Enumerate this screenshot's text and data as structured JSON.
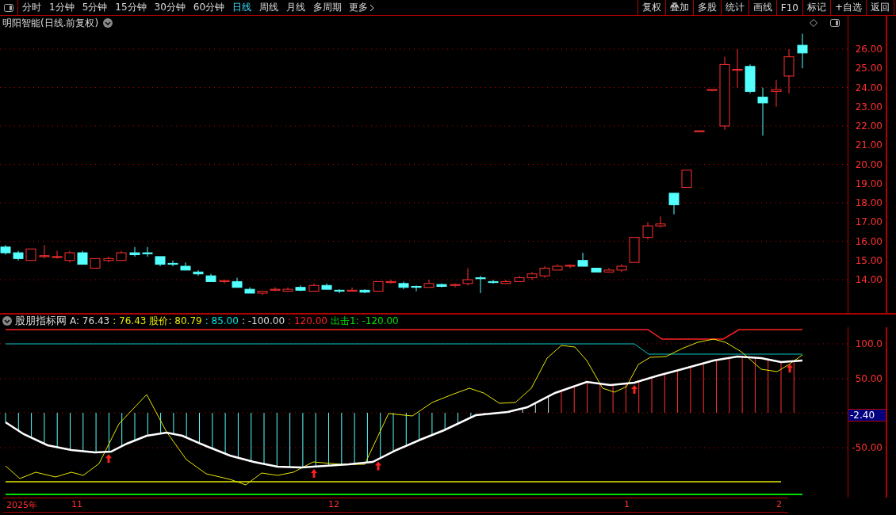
{
  "toolbar": {
    "periods": [
      {
        "label": "分时",
        "selected": false
      },
      {
        "label": "1分钟",
        "selected": false
      },
      {
        "label": "5分钟",
        "selected": false
      },
      {
        "label": "15分钟",
        "selected": false
      },
      {
        "label": "30分钟",
        "selected": false
      },
      {
        "label": "60分钟",
        "selected": false
      },
      {
        "label": "日线",
        "selected": true
      },
      {
        "label": "周线",
        "selected": false
      },
      {
        "label": "月线",
        "selected": false
      },
      {
        "label": "多周期",
        "selected": false
      }
    ],
    "more": "更多",
    "buttons": [
      "复权",
      "叠加",
      "多股",
      "统计",
      "画线",
      "F10",
      "标记",
      "+自选",
      "返回"
    ]
  },
  "stock_title": "明阳智能(日线.前复权)",
  "price_axis": [
    "26.00",
    "25.00",
    "24.00",
    "23.00",
    "22.00",
    "21.00",
    "20.00",
    "19.00",
    "18.00",
    "17.00",
    "16.00",
    "15.00",
    "14.00"
  ],
  "indicator": {
    "name": "股朋指标网",
    "values": [
      {
        "text": "A: 76.43",
        "color": "#dcdcdc"
      },
      {
        "text": ": 76.43",
        "color": "#e8e800"
      },
      {
        "text": "股价: 80.79",
        "color": "#e8e800"
      },
      {
        "text": ": 85.00",
        "color": "#00e0e0"
      },
      {
        "text": ": -100.00",
        "color": "#dcdcdc"
      },
      {
        "text": ": 120.00",
        "color": "#ff2020"
      },
      {
        "text": "出击1: -120.00",
        "color": "#00e000"
      }
    ]
  },
  "indicator_axis": [
    "100.0",
    "50.00",
    "-50.00"
  ],
  "current_value": "-2.40",
  "date_axis": [
    "2025年",
    "11",
    "12",
    "1",
    "2"
  ]
}
